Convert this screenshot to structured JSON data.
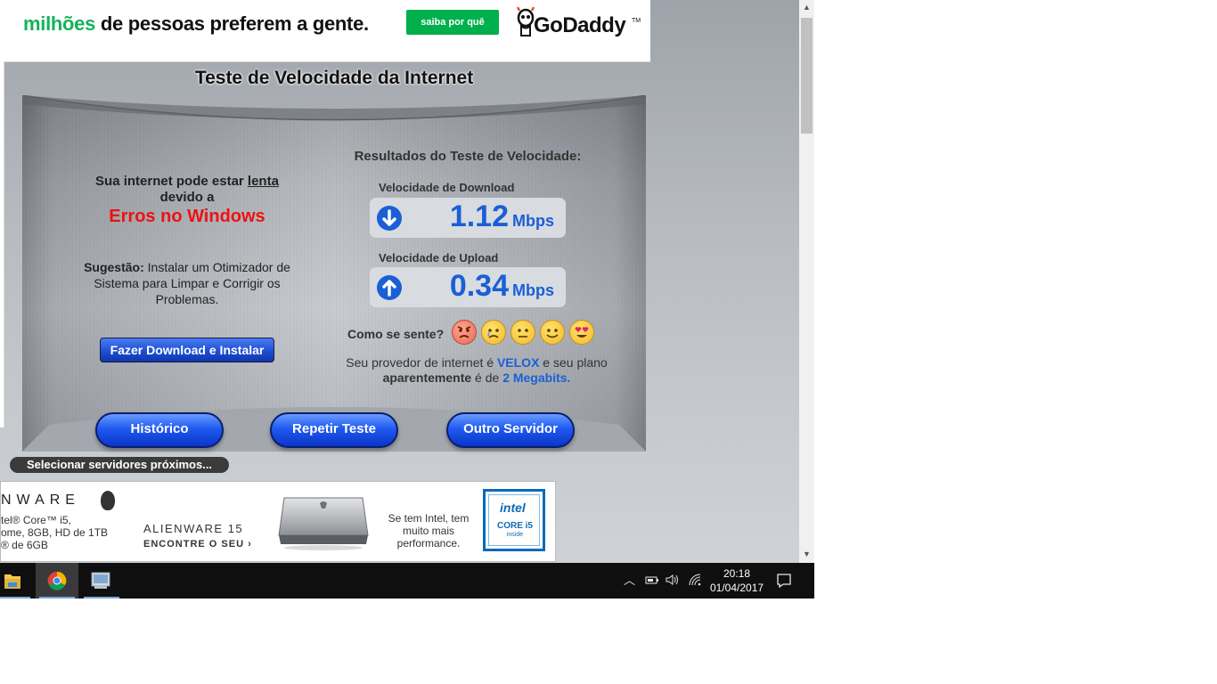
{
  "ad_top": {
    "headline_green": "milhões",
    "headline_rest": " de pessoas preferem a gente.",
    "cta": "saiba por quê",
    "logo": "GoDaddy",
    "logo_tm": "TM"
  },
  "page_title": "Teste de Velocidade da Internet",
  "warning": {
    "line1_pre": "Sua internet pode estar ",
    "line1_underlined": "lenta",
    "line2": "devido a",
    "reason": "Erros no Windows",
    "suggestion_label": "Sugestão:",
    "suggestion_text": " Instalar um Otimizador de Sistema para Limpar e Corrigir os Problemas.",
    "download_button": "Fazer Download e Instalar"
  },
  "results": {
    "title": "Resultados do Teste de Velocidade:",
    "download_label": "Velocidade de Download",
    "download_value": "1.12",
    "upload_label": "Velocidade de Upload",
    "upload_value": "0.34",
    "unit": "Mbps",
    "feel_label": "Como se sente?",
    "emojis": [
      "angry-face-icon",
      "crying-face-icon",
      "neutral-face-icon",
      "smile-face-icon",
      "heart-eyes-face-icon"
    ],
    "provider_pre": "Seu provedor de internet é ",
    "provider_name": "VELOX",
    "provider_mid": " e seu plano ",
    "provider_bold": "aparentemente",
    "provider_mid2": " é de ",
    "provider_plan": "2 Megabits."
  },
  "buttons": {
    "history": "Histórico",
    "repeat": "Repetir Teste",
    "other_server": "Outro Servidor"
  },
  "nearby_servers": "Selecionar servidores próximos...",
  "ad_bottom": {
    "brand": "NWARE",
    "specs": [
      "tel® Core™ i5,",
      "ome, 8GB, HD de 1TB",
      "® de 6GB"
    ],
    "model": "ALIENWARE 15",
    "cta": "ENCONTRE O SEU ›",
    "tagline": "Se tem Intel, tem muito mais performance.",
    "intel_word": "intel",
    "intel_core": "CORE i5",
    "intel_inside": "inside"
  },
  "taskbar": {
    "time": "20:18",
    "date": "01/04/2017"
  },
  "colors": {
    "accent_blue": "#1a5fd6",
    "warning_red": "#ee1111",
    "godaddy_green": "#00b04d"
  }
}
